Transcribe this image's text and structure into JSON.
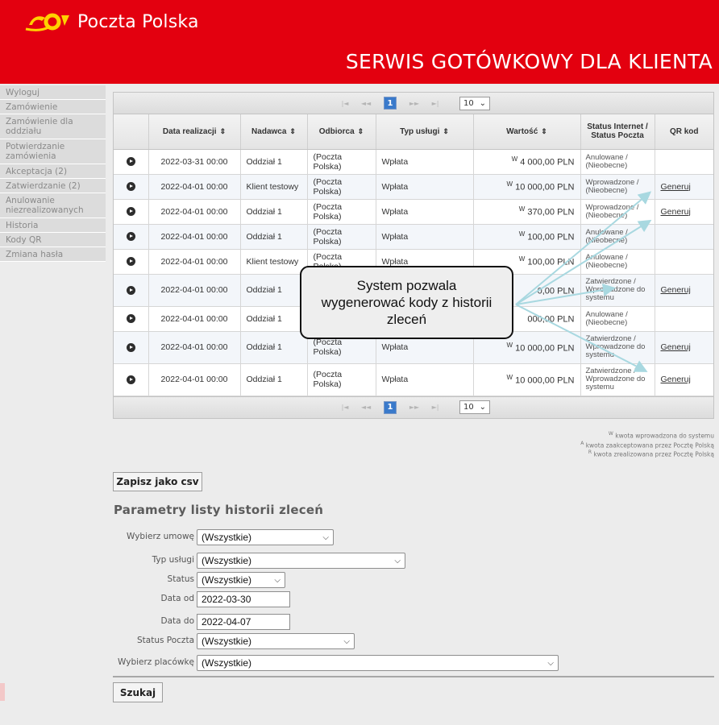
{
  "brand": {
    "logo_text": "Poczta Polska",
    "service_title": "SERWIS GOTÓWKOWY DLA KLIENTA",
    "brand_color": "#e3000f",
    "logo_color": "#ffd200"
  },
  "sidebar": {
    "items": [
      {
        "label": "Wyloguj"
      },
      {
        "label": "Zamówienie"
      },
      {
        "label": "Zamówienie dla oddziału"
      },
      {
        "label": "Potwierdzanie zamówienia"
      },
      {
        "label": "Akceptacja (2)"
      },
      {
        "label": "Zatwierdzanie (2)"
      },
      {
        "label": "Anulowanie niezrealizowanych"
      },
      {
        "label": "Historia"
      },
      {
        "label": "Kody QR"
      },
      {
        "label": "Zmiana hasła"
      }
    ]
  },
  "pager": {
    "first": "|◄",
    "prev": "◄◄",
    "current": "1",
    "next": "►►",
    "last": "►|",
    "page_size": "10"
  },
  "table": {
    "headers": [
      "Data realizacji",
      "Nadawca",
      "Odbiorca",
      "Typ usługi",
      "Wartość",
      "Status Internet / Status Poczta",
      "QR kod"
    ],
    "sort_icon": "⇕",
    "rows": [
      {
        "date": "2022-03-31 00:00",
        "sender": "Oddział 1",
        "recipient": "(Poczta Polska)",
        "type": "Wpłata",
        "value_mark": "W",
        "value": "4 000,00 PLN",
        "status": "Anulowane / (Nieobecne)",
        "qr": ""
      },
      {
        "date": "2022-04-01 00:00",
        "sender": "Klient testowy",
        "recipient": "(Poczta Polska)",
        "type": "Wpłata",
        "value_mark": "W",
        "value": "10 000,00 PLN",
        "status": "Wprowadzone / (Nieobecne)",
        "qr": "Generuj"
      },
      {
        "date": "2022-04-01 00:00",
        "sender": "Oddział 1",
        "recipient": "(Poczta Polska)",
        "type": "Wpłata",
        "value_mark": "W",
        "value": "370,00 PLN",
        "status": "Wprowadzone / (Nieobecne)",
        "qr": "Generuj"
      },
      {
        "date": "2022-04-01 00:00",
        "sender": "Oddział 1",
        "recipient": "(Poczta Polska)",
        "type": "Wpłata",
        "value_mark": "W",
        "value": "100,00 PLN",
        "status": "Anulowane / (Nieobecne)",
        "qr": ""
      },
      {
        "date": "2022-04-01 00:00",
        "sender": "Klient testowy",
        "recipient": "(Poczta Polska)",
        "type": "Wpłata",
        "value_mark": "W",
        "value": "100,00 PLN",
        "status": "Anulowane / (Nieobecne)",
        "qr": ""
      },
      {
        "date": "2022-04-01 00:00",
        "sender": "Oddział 1",
        "recipient": "",
        "type": "",
        "value_mark": "",
        "value": "0,00 PLN",
        "status": "Zatwierdzone / Wprowadzone do systemu",
        "qr": "Generuj"
      },
      {
        "date": "2022-04-01 00:00",
        "sender": "Oddział 1",
        "recipient": "",
        "type": "",
        "value_mark": "",
        "value": "000,00 PLN",
        "status": "Anulowane / (Nieobecne)",
        "qr": ""
      },
      {
        "date": "2022-04-01 00:00",
        "sender": "Oddział 1",
        "recipient": "(Poczta Polska)",
        "type": "Wpłata",
        "value_mark": "W",
        "value": "10 000,00 PLN",
        "status": "Zatwierdzone / Wprowadzone do systemu",
        "qr": "Generuj"
      },
      {
        "date": "2022-04-01 00:00",
        "sender": "Oddział 1",
        "recipient": "(Poczta Polska)",
        "type": "Wpłata",
        "value_mark": "W",
        "value": "10 000,00 PLN",
        "status": "Zatwierdzone / Wprowadzone do systemu",
        "qr": "Generuj"
      }
    ]
  },
  "callout": {
    "text": "System pozwala wygenerować kody z historii zleceń",
    "arrow_color": "#a8d8e0"
  },
  "legend": {
    "lines": [
      {
        "mark": "W",
        "text": "kwota wprowadzona do systemu"
      },
      {
        "mark": "A",
        "text": "kwota zaakceptowana przez Pocztę Polską"
      },
      {
        "mark": "R",
        "text": "kwota zrealizowana przez Pocztę Polską"
      }
    ]
  },
  "buttons": {
    "csv": "Zapisz jako csv",
    "search": "Szukaj"
  },
  "filters": {
    "title": "Parametry listy historii zleceń",
    "umowa": {
      "label": "Wybierz umowę",
      "value": "(Wszystkie)"
    },
    "typ": {
      "label": "Typ usługi",
      "value": "(Wszystkie)"
    },
    "status": {
      "label": "Status",
      "value": "(Wszystkie)"
    },
    "data_od": {
      "label": "Data od",
      "value": "2022-03-30"
    },
    "data_do": {
      "label": "Data do",
      "value": "2022-04-07"
    },
    "status_poczta": {
      "label": "Status Poczta",
      "value": "(Wszystkie)"
    },
    "placowka": {
      "label": "Wybierz placówkę",
      "value": "(Wszystkie)"
    }
  }
}
